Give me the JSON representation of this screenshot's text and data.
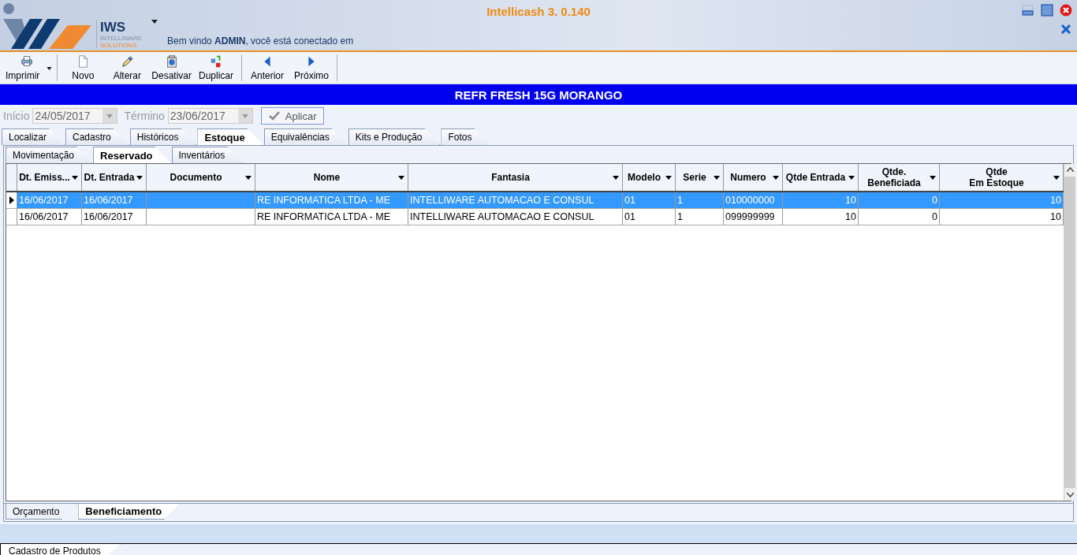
{
  "window": {
    "title": "Intellicash 3. 0.140"
  },
  "logo": {
    "name": "IWS",
    "line1": "INTELLIWARE",
    "line2": "SOLUTIONS"
  },
  "welcome": "Bem vindo **ADMIN**, você está conectado em",
  "toolbar": {
    "groups": [
      [
        {
          "label": "Imprimir",
          "has_menu": true
        }
      ],
      [
        {
          "label": "Novo",
          "has_menu": false
        },
        {
          "label": "Alterar",
          "has_menu": false
        },
        {
          "label": "Desativar",
          "has_menu": false
        },
        {
          "label": "Duplicar",
          "has_menu": false
        }
      ],
      [
        {
          "label": "Anterior",
          "has_menu": false
        },
        {
          "label": "Próximo",
          "has_menu": false
        }
      ]
    ]
  },
  "record_title": "REFR FRESH 15G MORANGO",
  "filter": {
    "start_label": "Início",
    "start_value": "24/05/2017",
    "end_label": "Término",
    "end_value": "23/06/2017",
    "disabled": true,
    "apply": "Aplicar"
  },
  "tabs": [
    {
      "label": "Localizar",
      "selected": false
    },
    {
      "label": "Cadastro",
      "selected": false
    },
    {
      "label": "Históricos",
      "selected": false
    },
    {
      "label": "Estoque",
      "selected": true
    },
    {
      "label": "Equivalências",
      "selected": false
    },
    {
      "label": "Kits e Produção",
      "selected": false
    },
    {
      "label": "Fotos",
      "selected": false
    }
  ],
  "subtabs": [
    {
      "label": "Movimentação",
      "selected": false
    },
    {
      "label": "Reservado",
      "selected": true
    },
    {
      "label": "Inventários",
      "selected": false
    }
  ],
  "table": {
    "columns": [
      {
        "label": "Dt. Emiss...",
        "kind": "text"
      },
      {
        "label": "Dt. Entrada",
        "kind": "text"
      },
      {
        "label": "Documento",
        "kind": "text"
      },
      {
        "label": "Nome",
        "kind": "text"
      },
      {
        "label": "Fantasia",
        "kind": "text"
      },
      {
        "label": "Modelo",
        "kind": "text"
      },
      {
        "label": "Serie",
        "kind": "text"
      },
      {
        "label": "Numero",
        "kind": "text"
      },
      {
        "label": "Qtde Entrada",
        "kind": "number"
      },
      {
        "label": "Qtde.\nBeneficiada",
        "kind": "number"
      },
      {
        "label": "Qtde\nEm Estoque",
        "kind": "number"
      }
    ],
    "rows": [
      {
        "selected": true,
        "cells": [
          "16/06/2017",
          "16/06/2017",
          "",
          "RE INFORMATICA LTDA - ME",
          "INTELLIWARE AUTOMACAO E CONSUL",
          "01",
          "1",
          "010000000",
          "10",
          "0",
          "10"
        ]
      },
      {
        "selected": false,
        "cells": [
          "16/06/2017",
          "16/06/2017",
          "",
          "RE INFORMATICA LTDA - ME",
          "INTELLIWARE AUTOMACAO E CONSUL",
          "01",
          "1",
          "099999999",
          "10",
          "0",
          "10"
        ]
      }
    ]
  },
  "bottom_tabs": [
    {
      "label": "Orçamento",
      "selected": false
    },
    {
      "label": "Beneficiamento",
      "selected": true
    }
  ],
  "taskbar": [
    {
      "label": "Cadastro de Produtos",
      "selected": true
    }
  ]
}
